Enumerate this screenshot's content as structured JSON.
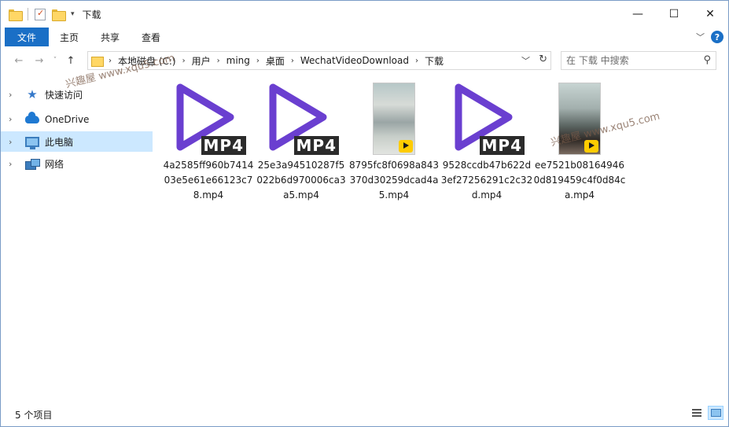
{
  "window": {
    "title": "下载",
    "controls": {
      "minimize": "—",
      "maximize": "☐",
      "close": "✕"
    }
  },
  "ribbon": {
    "tabs": [
      "文件",
      "主页",
      "共享",
      "查看"
    ],
    "expand_icon": "chevron-down-icon",
    "help_label": "?"
  },
  "address": {
    "breadcrumbs": [
      "本地磁盘 (C:)",
      "用户",
      "ming",
      "桌面",
      "WechatVideoDownload",
      "下载"
    ]
  },
  "search": {
    "placeholder": "在 下载 中搜索"
  },
  "sidebar": {
    "items": [
      {
        "label": "快速访问",
        "icon": "star-icon",
        "selected": false
      },
      {
        "label": "OneDrive",
        "icon": "cloud-icon",
        "selected": false
      },
      {
        "label": "此电脑",
        "icon": "monitor-icon",
        "selected": true
      },
      {
        "label": "网络",
        "icon": "network-icon",
        "selected": false
      }
    ]
  },
  "files": [
    {
      "name": "4a2585ff960b741403e5e61e66123c78.mp4",
      "thumb": "mp4-play-icon",
      "badge": "MP4"
    },
    {
      "name": "25e3a94510287f5022b6d970006ca3a5.mp4",
      "thumb": "mp4-play-icon",
      "badge": "MP4"
    },
    {
      "name": "8795fc8f0698a843370d30259dcad4a5.mp4",
      "thumb": "video-frame"
    },
    {
      "name": "9528ccdb47b622d3ef27256291c2c32d.mp4",
      "thumb": "mp4-play-icon",
      "badge": "MP4"
    },
    {
      "name": "ee7521b081649460d819459c4f0d84ca.mp4",
      "thumb": "video-frame"
    }
  ],
  "status": {
    "item_count": "5 个项目"
  },
  "watermarks": [
    "兴趣屋 www.xqu5.com",
    "兴趣屋 www.xqu5.com"
  ],
  "colors": {
    "accent": "#1a6fc6",
    "play_icon": "#6a3fd0",
    "selection": "#cce8ff"
  }
}
